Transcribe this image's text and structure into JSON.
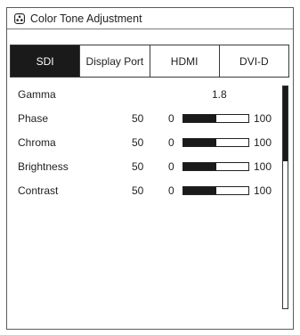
{
  "window": {
    "title": "Color Tone Adjustment",
    "icon": "palette-icon"
  },
  "tabs": [
    {
      "label": "SDI",
      "active": true
    },
    {
      "label": "Display Port",
      "active": false
    },
    {
      "label": "HDMI",
      "active": false
    },
    {
      "label": "DVI-D",
      "active": false
    }
  ],
  "settings": {
    "gamma": {
      "label": "Gamma",
      "value": "1.8"
    },
    "phase": {
      "label": "Phase",
      "value": "50",
      "min": "0",
      "max": "100",
      "level": 0.5
    },
    "chroma": {
      "label": "Chroma",
      "value": "50",
      "min": "0",
      "max": "100",
      "level": 0.5
    },
    "brightness": {
      "label": "Brightness",
      "value": "50",
      "min": "0",
      "max": "100",
      "level": 0.5
    },
    "contrast": {
      "label": "Contrast",
      "value": "50",
      "min": "0",
      "max": "100",
      "level": 0.5
    }
  },
  "scrollbar": {
    "position": 0
  }
}
